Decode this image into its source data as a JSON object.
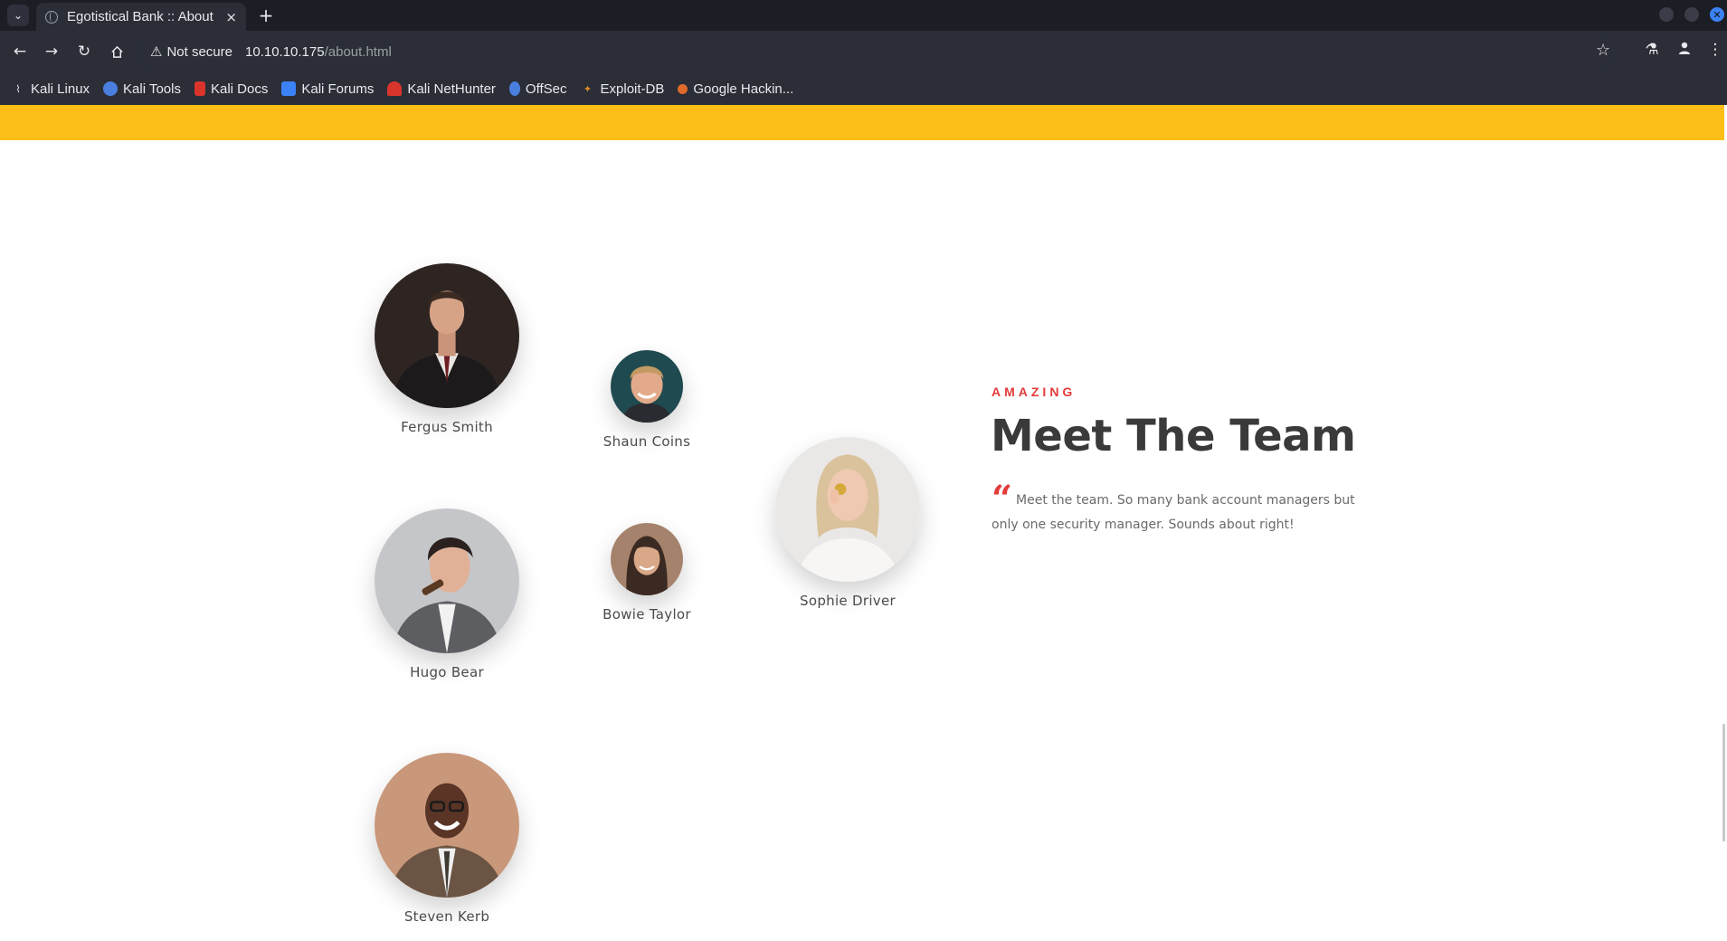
{
  "browser": {
    "tab_title": "Egotistical Bank :: About",
    "tab_close": "×",
    "new_tab": "+",
    "not_secure": "Not secure",
    "url_host": "10.10.10.175",
    "url_path": "/about.html",
    "bookmarks": [
      {
        "label": "Kali Linux",
        "icon": "kali-linux-icon",
        "color": "#e8eaed"
      },
      {
        "label": "Kali Tools",
        "icon": "kali-tools-icon",
        "color": "#4a7fe0"
      },
      {
        "label": "Kali Docs",
        "icon": "kali-docs-icon",
        "color": "#d9342b"
      },
      {
        "label": "Kali Forums",
        "icon": "kali-forums-icon",
        "color": "#3b82f6"
      },
      {
        "label": "Kali NetHunter",
        "icon": "kali-nethunter-icon",
        "color": "#d9342b"
      },
      {
        "label": "OffSec",
        "icon": "offsec-icon",
        "color": "#4a7fe0"
      },
      {
        "label": "Exploit-DB",
        "icon": "exploit-db-icon",
        "color": "#e08a2a"
      },
      {
        "label": "Google Hackin...",
        "icon": "google-hacking-icon",
        "color": "#e06a2a"
      }
    ]
  },
  "page": {
    "accent_color": "#fbbf17",
    "eyebrow": "AMAZING",
    "heading": "Meet The Team",
    "quote": "Meet the team. So many bank account managers but only one security manager. Sounds about right!",
    "team": [
      {
        "name": "Fergus Smith"
      },
      {
        "name": "Shaun Coins"
      },
      {
        "name": "Sophie Driver"
      },
      {
        "name": "Hugo Bear"
      },
      {
        "name": "Bowie Taylor"
      },
      {
        "name": "Steven Kerb"
      }
    ]
  }
}
